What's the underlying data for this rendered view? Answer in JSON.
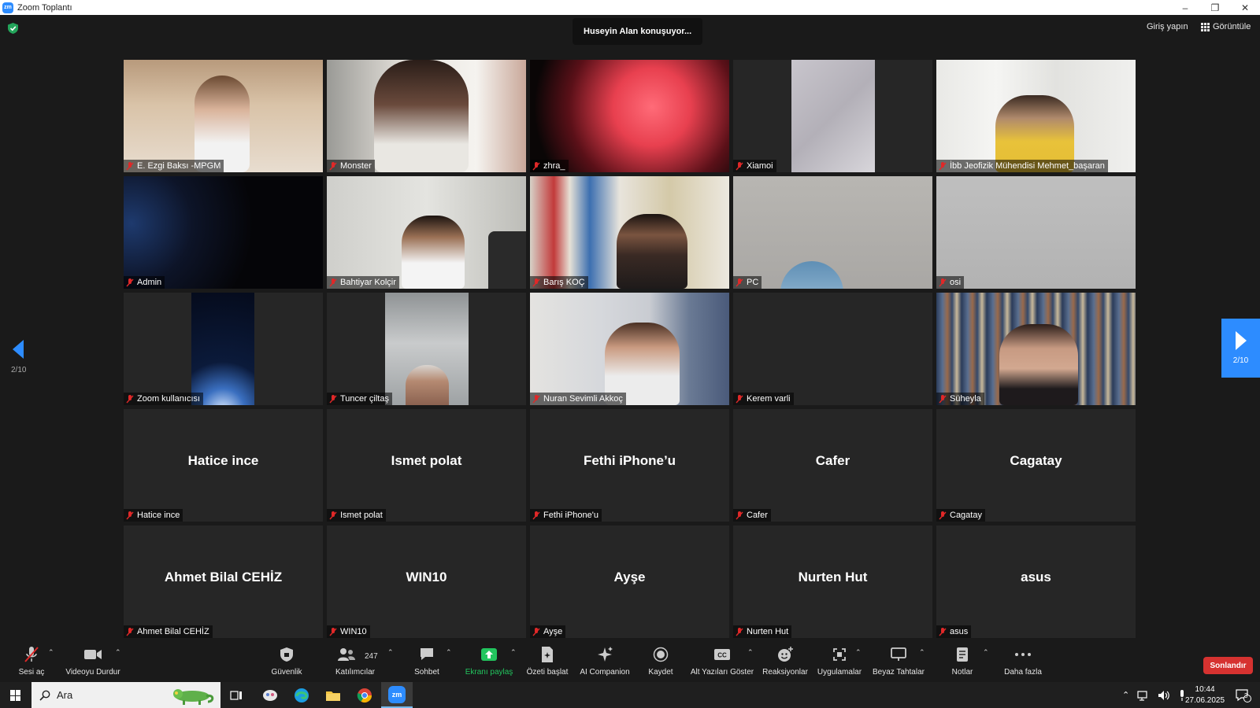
{
  "window": {
    "title": "Zoom Toplantı",
    "logo_text": "zm"
  },
  "topbar": {
    "speaking": "Huseyin Alan konuşuyor...",
    "signin": "Giriş yapın",
    "view": "Görüntüle"
  },
  "pager": {
    "left_count": "2/10",
    "right_count": "2/10"
  },
  "participants": [
    {
      "name": "E. Ezgi Baksı -MPGM",
      "muted": true
    },
    {
      "name": "Monster",
      "muted": true
    },
    {
      "name": "zhra_",
      "muted": true
    },
    {
      "name": "Xiamoi",
      "muted": true
    },
    {
      "name": "İbb Jeofizik Mühendisi Mehmet_başaran",
      "muted": true
    },
    {
      "name": "Admin",
      "muted": true
    },
    {
      "name": "Bahtiyar Kolçir",
      "muted": true
    },
    {
      "name": "Barış KOÇ",
      "muted": true
    },
    {
      "name": "PC",
      "muted": true
    },
    {
      "name": "osi",
      "muted": true
    },
    {
      "name": "Zoom kullanıcısı",
      "muted": true
    },
    {
      "name": "Tuncer çiltaş",
      "muted": true
    },
    {
      "name": "Nuran Sevimli Akkoç",
      "muted": true
    },
    {
      "name": "Kerem varli",
      "muted": true
    },
    {
      "name": "Süheyla",
      "muted": true
    },
    {
      "name": "Hatice ince",
      "display": "Hatice ince",
      "muted": true
    },
    {
      "name": "Ismet polat",
      "display": "Ismet polat",
      "muted": true
    },
    {
      "name": "Fethi iPhone'u",
      "display": "Fethi iPhone’u",
      "muted": true
    },
    {
      "name": "Cafer",
      "display": "Cafer",
      "muted": true
    },
    {
      "name": "Cagatay",
      "display": "Cagatay",
      "muted": true
    },
    {
      "name": "Ahmet Bilal CEHİZ",
      "display": "Ahmet Bilal CEHİZ",
      "muted": true
    },
    {
      "name": "WIN10",
      "display": "WIN10",
      "muted": true
    },
    {
      "name": "Ayşe",
      "display": "Ayşe",
      "muted": true
    },
    {
      "name": "Nurten Hut",
      "display": "Nurten Hut",
      "muted": true
    },
    {
      "name": "asus",
      "display": "asus",
      "muted": true
    }
  ],
  "toolbar": {
    "unmute": "Sesi aç",
    "stop_video": "Videoyu Durdur",
    "security": "Güvenlik",
    "participants": "Katılımcılar",
    "participants_count": "247",
    "chat": "Sohbet",
    "share": "Ekranı paylaş",
    "summary": "Özeti başlat",
    "ai": "AI Companion",
    "record": "Kaydet",
    "captions": "Alt Yazıları Göster",
    "reactions": "Reaksiyonlar",
    "apps": "Uygulamalar",
    "whiteboards": "Beyaz Tahtalar",
    "notes": "Notlar",
    "more": "Daha fazla",
    "end": "Sonlandır",
    "share_color": "#22c55e",
    "end_color": "#d63230"
  },
  "taskbar": {
    "search": "Ara",
    "time": "10:44",
    "date": "27.06.2025",
    "notifications": "3",
    "zoom_label": "zm"
  }
}
